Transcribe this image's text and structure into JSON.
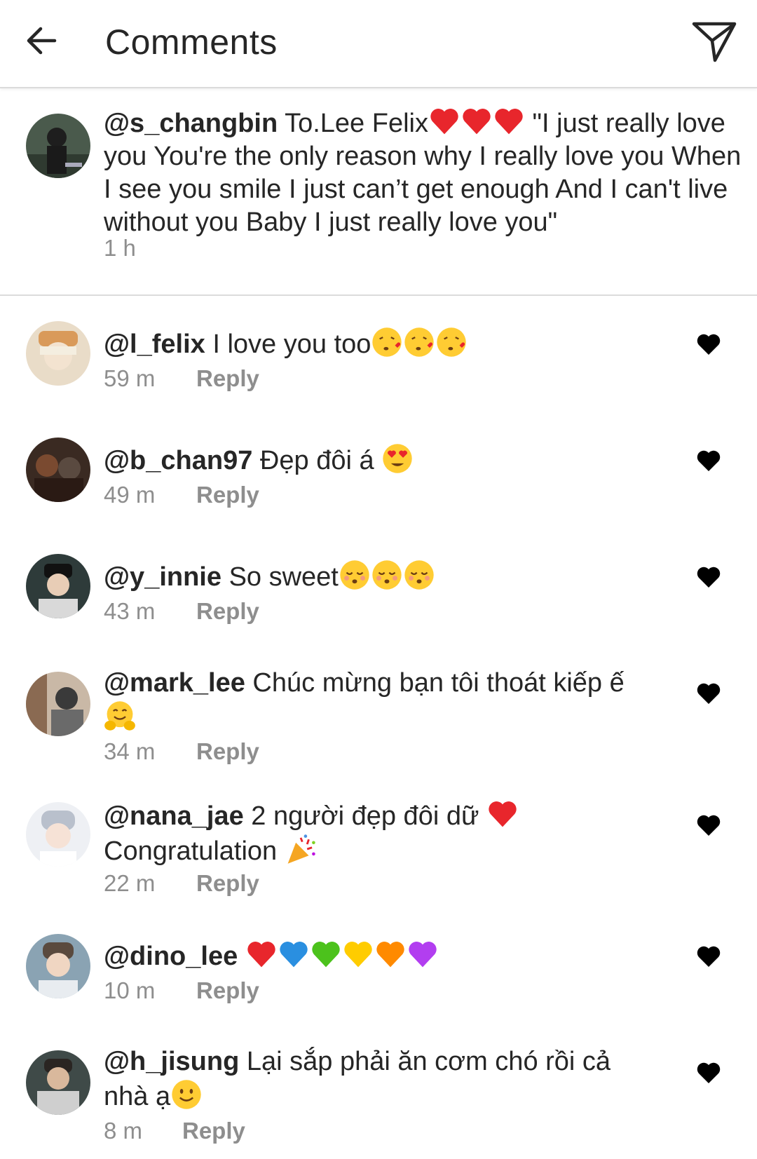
{
  "header": {
    "title": "Comments"
  },
  "caption": {
    "username": "@s_changbin",
    "text_before_emoji": "To.Lee Felix",
    "text_after_emoji": "\"I just really love you You're the only reason why I really love you When I see you smile I just can’t get enough And I can't live without you Baby I just really love you\"",
    "time": "1 h",
    "emojis": [
      "heart-red",
      "heart-red",
      "heart-red"
    ]
  },
  "comments": [
    {
      "username": "@l_felix",
      "text": "I love you too",
      "emojis": [
        "kissing-heart",
        "kissing-heart",
        "kissing-heart"
      ],
      "time": "59 m",
      "reply_label": "Reply"
    },
    {
      "username": "@b_chan97",
      "text": "Đẹp đôi á",
      "emojis": [
        "heart-eyes"
      ],
      "time": "49 m",
      "reply_label": "Reply"
    },
    {
      "username": "@y_innie",
      "text": "So sweet",
      "emojis": [
        "kissing-closed-eyes",
        "kissing-closed-eyes",
        "kissing-closed-eyes"
      ],
      "time": "43 m",
      "reply_label": "Reply"
    },
    {
      "username": "@mark_lee",
      "text": "Chúc mừng bạn tôi thoát kiếp ế",
      "emojis": [
        "hugging"
      ],
      "time": "34 m",
      "reply_label": "Reply"
    },
    {
      "username": "@nana_jae",
      "text": "2 người đẹp đôi dữ",
      "text2": "Congratulation",
      "emojis": [
        "heart-red"
      ],
      "emojis2": [
        "party-popper"
      ],
      "time": "22 m",
      "reply_label": "Reply"
    },
    {
      "username": "@dino_lee",
      "text": "",
      "emojis": [
        "heart-red",
        "heart-blue",
        "heart-green",
        "heart-yellow",
        "heart-orange",
        "heart-purple"
      ],
      "time": "10 m",
      "reply_label": "Reply"
    },
    {
      "username": "@h_jisung",
      "text": "Lại sắp phải ăn cơm chó rồi cả nhà ạ",
      "emojis": [
        "smiling-face"
      ],
      "time": "8 m",
      "reply_label": "Reply"
    }
  ],
  "icons": {
    "back": "arrow-left-icon",
    "share": "paper-plane-icon",
    "like": "heart-filled-icon"
  },
  "colors": {
    "text": "#262626",
    "meta": "#8e8e8e",
    "divider": "#dbdbdb",
    "heart_icon": "#000000"
  }
}
